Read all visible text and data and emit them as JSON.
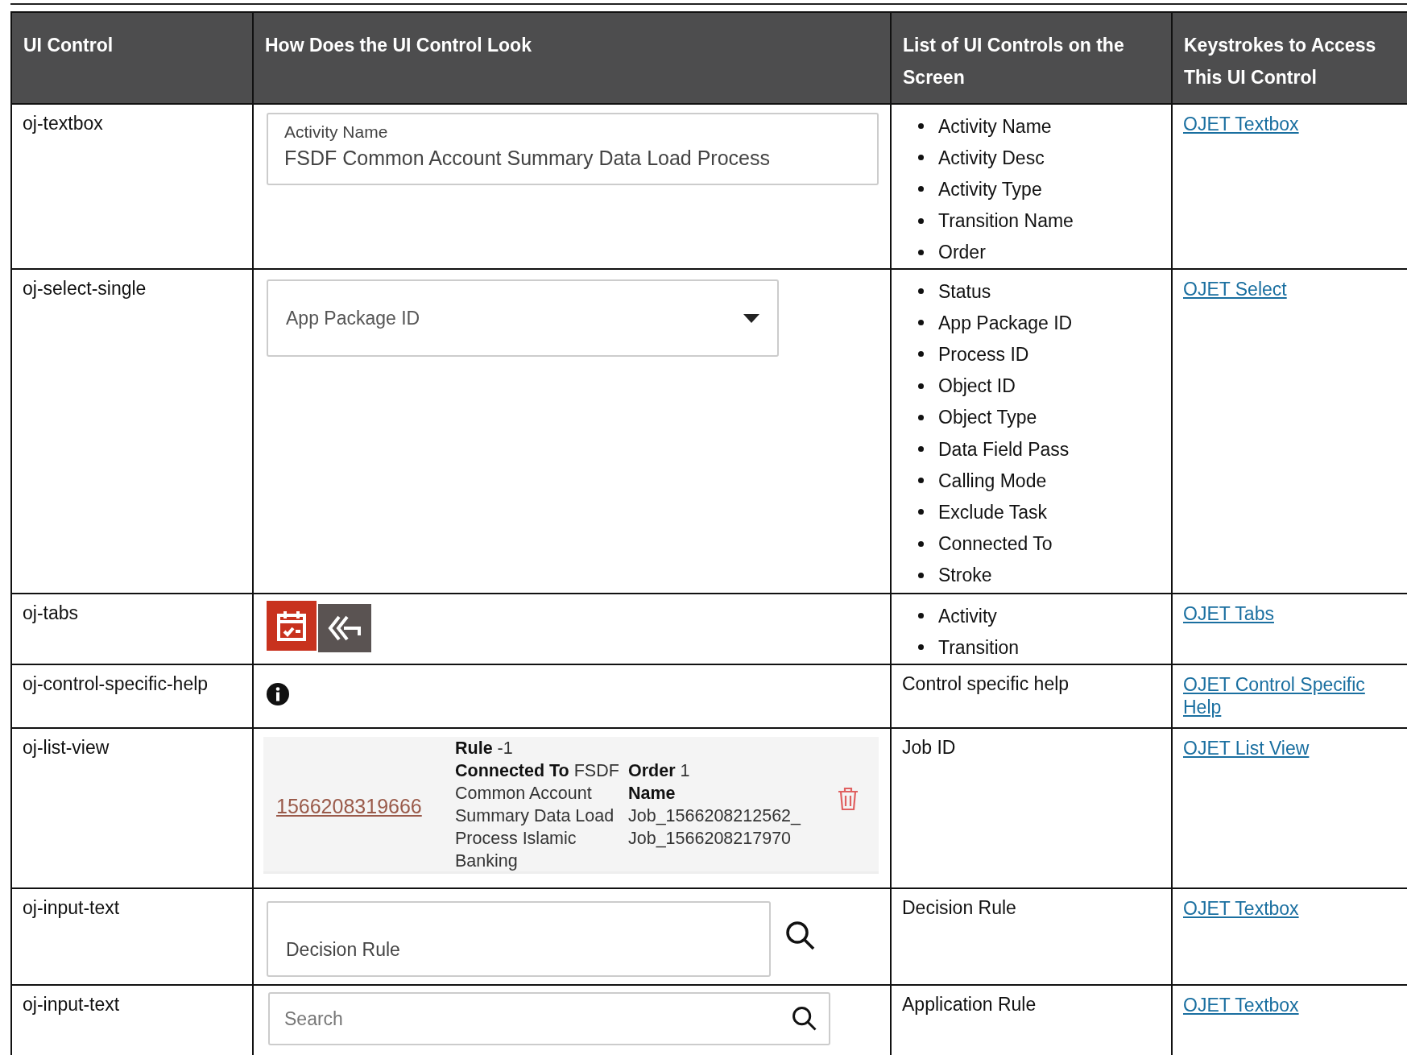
{
  "table": {
    "columns": [
      "UI Control",
      "How Does the UI Control Look",
      "List of UI Controls on the Screen",
      "Keystrokes to Access This UI Control"
    ],
    "rows": [
      {
        "control": "oj-textbox",
        "look": {
          "kind": "textbox",
          "label": "Activity Name",
          "value": "FSDF Common Account Summary Data Load Process"
        },
        "items": [
          "Activity Name",
          "Activity Desc",
          "Activity Type",
          "Transition Name",
          "Order"
        ],
        "link": "OJET Textbox"
      },
      {
        "control": "oj-select-single",
        "look": {
          "kind": "select",
          "placeholder": "App Package ID"
        },
        "items": [
          "Status",
          "App Package ID",
          "Process ID",
          "Object ID",
          "Object Type",
          "Data Field Pass",
          "Calling Mode",
          "Exclude Task",
          "Connected To",
          "Stroke"
        ],
        "link": "OJET Select"
      },
      {
        "control": "oj-tabs",
        "look": {
          "kind": "tabs",
          "tabs": [
            {
              "selected": true
            },
            {
              "selected": false
            }
          ]
        },
        "items": [
          "Activity",
          "Transition"
        ],
        "link": "OJET Tabs"
      },
      {
        "control": "oj-control-specific-help",
        "look": {
          "kind": "help"
        },
        "text": "Control specific help",
        "link": "OJET Control Specific Help"
      },
      {
        "control": "oj-list-view",
        "look": {
          "kind": "listview",
          "id": "1566208319666",
          "left": [
            "**Rule** -1",
            "**Connected To** FSDF Common Account Summary Data Load Process Islamic Banking"
          ],
          "right": [
            "**Order** 1",
            "**Name**",
            "Job_1566208212562_",
            "Job_1566208217970"
          ]
        },
        "text": "Job ID",
        "link": "OJET List View"
      },
      {
        "control": "oj-input-text",
        "look": {
          "kind": "input-outside",
          "placeholder": "Decision Rule"
        },
        "text": "Decision Rule",
        "link": "OJET Textbox"
      },
      {
        "control": "oj-input-text",
        "look": {
          "kind": "input-inside",
          "placeholder": "Search"
        },
        "text": "Application Rule",
        "link": "OJET Textbox"
      }
    ]
  }
}
